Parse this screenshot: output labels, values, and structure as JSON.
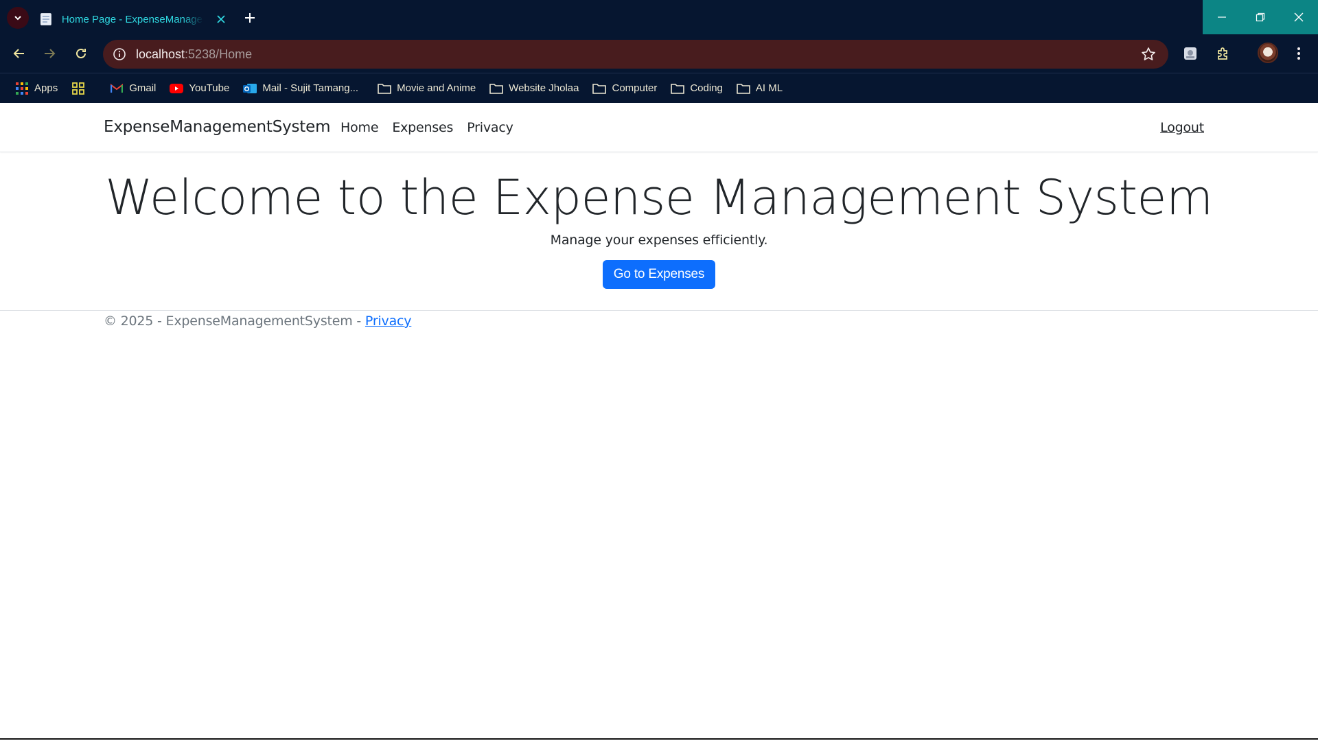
{
  "browser": {
    "tab": {
      "title": "Home Page - ExpenseManagementSystem"
    },
    "address": {
      "host": "localhost",
      "path": ":5238/Home"
    },
    "bookmarks": [
      {
        "label": "Apps",
        "icon": "apps-grid-icon"
      },
      {
        "label": "",
        "icon": "tab-groups-icon"
      },
      {
        "label": "Gmail",
        "icon": "gmail-icon"
      },
      {
        "label": "YouTube",
        "icon": "youtube-icon"
      },
      {
        "label": "Mail - Sujit Tamang...",
        "icon": "outlook-icon"
      },
      {
        "label": "Movie and Anime",
        "icon": "folder-icon"
      },
      {
        "label": "Website Jholaa",
        "icon": "folder-icon"
      },
      {
        "label": "Computer",
        "icon": "folder-icon"
      },
      {
        "label": "Coding",
        "icon": "folder-icon"
      },
      {
        "label": "AI ML",
        "icon": "folder-icon"
      }
    ],
    "colors": {
      "chrome_bg": "#061630",
      "omnibox_bg": "#481c1e",
      "tab_text": "#2fd7e0",
      "window_controls": "#0c8585"
    }
  },
  "app": {
    "brand": "ExpenseManagementSystem",
    "nav": [
      {
        "label": "Home"
      },
      {
        "label": "Expenses"
      },
      {
        "label": "Privacy"
      }
    ],
    "logout": "Logout"
  },
  "hero": {
    "title": "Welcome to the Expense Management System",
    "subtitle": "Manage your expenses efficiently.",
    "button": "Go to Expenses"
  },
  "footer": {
    "text": "© 2025 - ExpenseManagementSystem - ",
    "link": "Privacy"
  },
  "colors": {
    "primary": "#0d6efd",
    "text": "#212529",
    "muted": "#6c757d"
  }
}
